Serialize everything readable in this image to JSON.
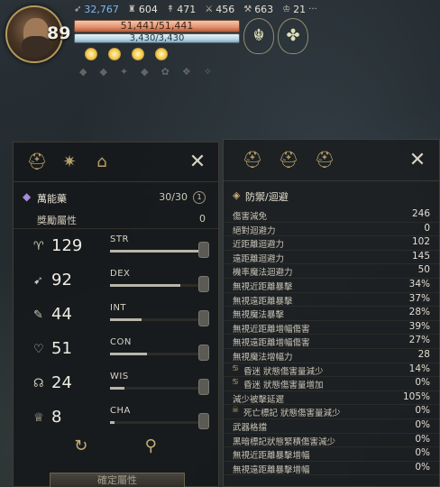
{
  "hud": {
    "level": "89",
    "stats": [
      {
        "icon": "wing-icon",
        "value": "32,767",
        "color": "blue"
      },
      {
        "icon": "fortress-icon",
        "value": "604",
        "color": "white"
      },
      {
        "icon": "arrows-icon",
        "value": "471",
        "color": "white"
      },
      {
        "icon": "sword-icon",
        "value": "456",
        "color": "white"
      },
      {
        "icon": "blade-icon",
        "value": "663",
        "color": "white"
      },
      {
        "icon": "trophy-icon",
        "value": "21",
        "color": "white"
      }
    ],
    "hp": "51,441/51,441",
    "mp": "3,430/3,430"
  },
  "left": {
    "potion_name": "萬能藥",
    "potion_count": "30/30",
    "potion_badge": "1",
    "bonus_label": "獎勵屬性",
    "bonus_value": "0",
    "attributes": [
      {
        "icon": "strength-icon",
        "value": "129",
        "name": "STR",
        "fill": 0.98
      },
      {
        "icon": "dexterity-icon",
        "value": "92",
        "name": "DEX",
        "fill": 0.78
      },
      {
        "icon": "intelligence-icon",
        "value": "44",
        "name": "INT",
        "fill": 0.35
      },
      {
        "icon": "constitution-icon",
        "value": "51",
        "name": "CON",
        "fill": 0.41
      },
      {
        "icon": "wisdom-icon",
        "value": "24",
        "name": "WIS",
        "fill": 0.16
      },
      {
        "icon": "charisma-icon",
        "value": "8",
        "name": "CHA",
        "fill": 0.05
      }
    ],
    "confirm_label": "確定屬性"
  },
  "right": {
    "section_title": "防禦/迴避",
    "rows": [
      {
        "label": "傷害減免",
        "value": "246"
      },
      {
        "label": "絕對迴避力",
        "value": "0"
      },
      {
        "label": "近距離迴避力",
        "value": "102"
      },
      {
        "label": "遠距離迴避力",
        "value": "145"
      },
      {
        "label": "機率魔法迴避力",
        "value": "50"
      },
      {
        "label": "無視近距離暴擊",
        "value": "34%"
      },
      {
        "label": "無視遠距離暴擊",
        "value": "37%"
      },
      {
        "label": "無視魔法暴擊",
        "value": "28%"
      },
      {
        "label": "無視近距離增幅傷害",
        "value": "39%"
      },
      {
        "label": "無視遠距離增幅傷害",
        "value": "27%"
      },
      {
        "label": "無視魔法增幅力",
        "value": "28"
      },
      {
        "label": "昏迷 狀態傷害量減少",
        "value": "14%",
        "icon": "swirl-icon"
      },
      {
        "label": "昏迷 狀態傷害量增加",
        "value": "0%",
        "icon": "swirl-icon"
      },
      {
        "label": "減少被擊延遲",
        "value": "105%"
      },
      {
        "label": "死亡標記 狀態傷害量減少",
        "value": "0%",
        "icon": "skull-icon"
      },
      {
        "label": "武器格擋",
        "value": "0%"
      },
      {
        "label": "黑暗標記狀態緊積傷害減少",
        "value": "0%"
      },
      {
        "label": "無視近距離暴擊增幅",
        "value": "0%"
      },
      {
        "label": "無視遠距離暴擊增幅",
        "value": "0%"
      }
    ]
  }
}
